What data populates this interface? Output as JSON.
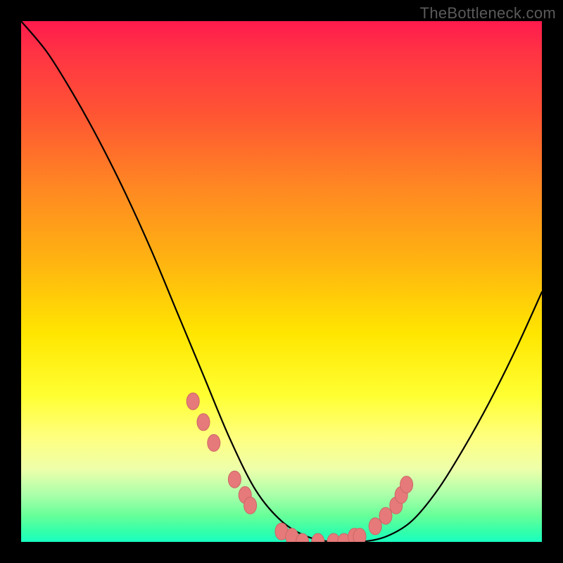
{
  "watermark": "TheBottleneck.com",
  "colors": {
    "background": "#000000",
    "curve": "#000000",
    "marker_fill": "#e67a7a",
    "marker_stroke": "#cc6666"
  },
  "chart_data": {
    "type": "line",
    "title": "",
    "xlabel": "",
    "ylabel": "",
    "xlim": [
      0,
      100
    ],
    "ylim": [
      0,
      100
    ],
    "grid": false,
    "legend": false,
    "x": [
      0,
      5,
      10,
      15,
      20,
      25,
      30,
      35,
      40,
      45,
      50,
      55,
      60,
      65,
      70,
      75,
      80,
      85,
      90,
      95,
      100
    ],
    "values": [
      100,
      94,
      86,
      77,
      67,
      56,
      44,
      32,
      20,
      10,
      4,
      1,
      0,
      0,
      1,
      4,
      10,
      18,
      27,
      37,
      48
    ],
    "markers": {
      "x": [
        33,
        35,
        37,
        41,
        43,
        44,
        50,
        52,
        54,
        57,
        60,
        62,
        64,
        65,
        68,
        70,
        72,
        73,
        74
      ],
      "y": [
        27,
        23,
        19,
        12,
        9,
        7,
        2,
        1,
        0,
        0,
        0,
        0,
        1,
        1,
        3,
        5,
        7,
        9,
        11
      ]
    }
  }
}
